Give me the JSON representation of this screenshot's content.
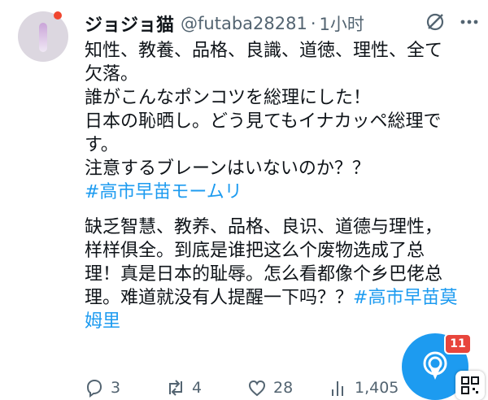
{
  "author": {
    "display_name": "ジョジョ猫",
    "handle": "@futaba28281",
    "separator": "·",
    "time": "1小时"
  },
  "tweet": {
    "jp_lines": [
      "知性、教養、品格、良識、道徳、理性、全て",
      "欠落。",
      "誰がこんなポンコツを総理にした！",
      "日本の恥晒し。どう見てもイナカッペ総理で",
      "す。",
      "注意するブレーンはいないのか？？"
    ],
    "jp_hashtag": "#高市早苗モームリ",
    "cn_lines": [
      "缺乏智慧、教养、品格、良识、道德与理性，",
      "样样俱全。到底是谁把这么个废物选成了总",
      "理！真是日本的耻辱。怎么看都像个乡巴佬总"
    ],
    "cn_last_line_text": "理。难道就没有人提醒一下吗？？",
    "cn_hashtag_part1": "#高市早苗莫",
    "cn_hashtag_part2": "姆里"
  },
  "actions": {
    "replies": "3",
    "retweets": "4",
    "likes": "28",
    "views": "1,405"
  },
  "fab": {
    "badge": "11"
  },
  "colors": {
    "link": "#1d9bf0",
    "muted": "#536471",
    "badge": "#e8453c"
  },
  "icons": [
    "grok-icon",
    "more-icon",
    "reply-icon",
    "retweet-icon",
    "like-icon",
    "views-icon",
    "spaces-icon",
    "qr-icon"
  ]
}
